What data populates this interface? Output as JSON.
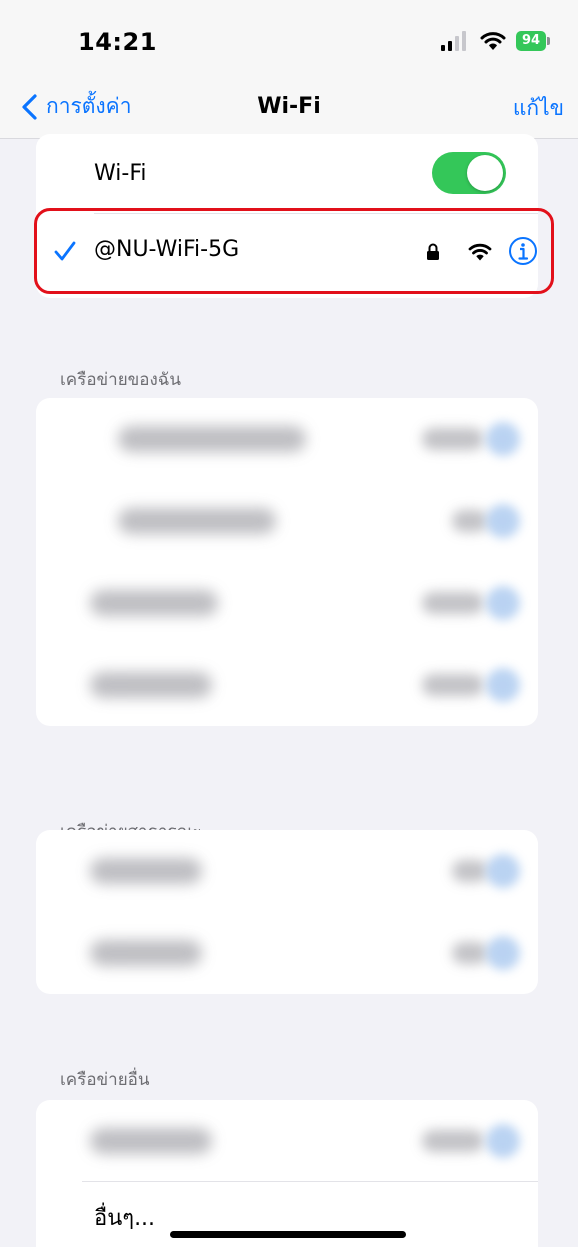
{
  "status_bar": {
    "time": "14:21",
    "battery": "94"
  },
  "nav": {
    "back_label": "การตั้งค่า",
    "title": "Wi-Fi",
    "edit_label": "แก้ไข"
  },
  "wifi_toggle": {
    "label": "Wi-Fi",
    "state": "on"
  },
  "connected_network": {
    "name": "@NU-WiFi-5G",
    "secured": true
  },
  "sections": {
    "my_networks": "เครือข่ายของฉัน",
    "public_networks": "เครือข่ายสาธารณะ",
    "other_networks": "เครือข่ายอื่น"
  },
  "other_option_label": "อื่นๆ...",
  "colors": {
    "accent": "#0a74ff",
    "toggle_on": "#34c759",
    "highlight": "#e2101a",
    "background": "#f2f2f7"
  },
  "icons": [
    "cellular-signal-icon",
    "wifi-icon",
    "battery-icon",
    "chevron-left-icon",
    "checkmark-icon",
    "lock-icon",
    "info-icon"
  ]
}
